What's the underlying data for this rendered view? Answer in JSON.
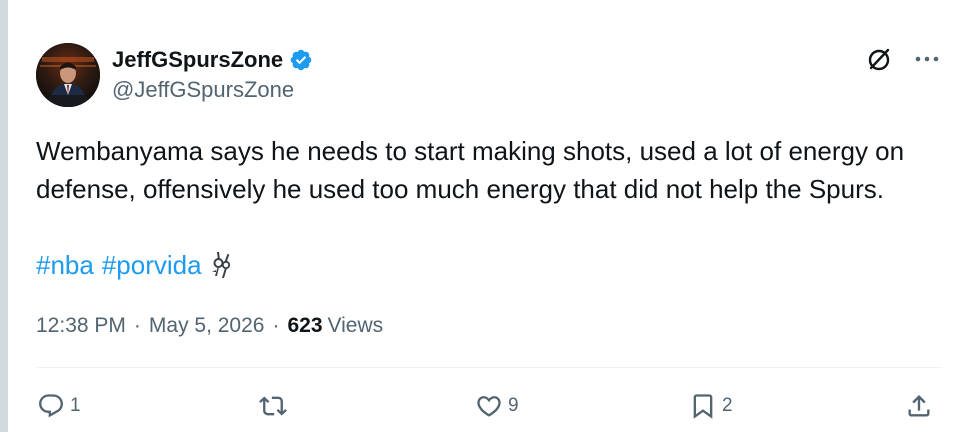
{
  "author": {
    "display_name": "JeffGSpursZone",
    "handle": "@JeffGSpursZone",
    "verified": true,
    "verified_color": "#1d9bf0"
  },
  "tweet": {
    "text": "Wembanyama says he needs to start making shots, used a lot of energy on defense, offensively he used too much energy that did not help the Spurs.",
    "hashtags": [
      "#nba",
      "#porvida"
    ],
    "emoji_icon": "spurs-icon",
    "timestamp": "12:38 PM",
    "separator": "·",
    "date": "May 5, 2026",
    "views_count": "623",
    "views_label": "Views"
  },
  "actions": {
    "reply_count": "1",
    "retweet_count": "",
    "like_count": "9",
    "bookmark_count": "2"
  },
  "icons": {
    "grok": "grok-icon",
    "more": "more-icon",
    "reply": "reply-icon",
    "retweet": "retweet-icon",
    "like": "heart-icon",
    "bookmark": "bookmark-icon",
    "share": "share-icon"
  },
  "colors": {
    "link": "#1d9bf0",
    "text": "#0f1419",
    "muted": "#536471"
  }
}
